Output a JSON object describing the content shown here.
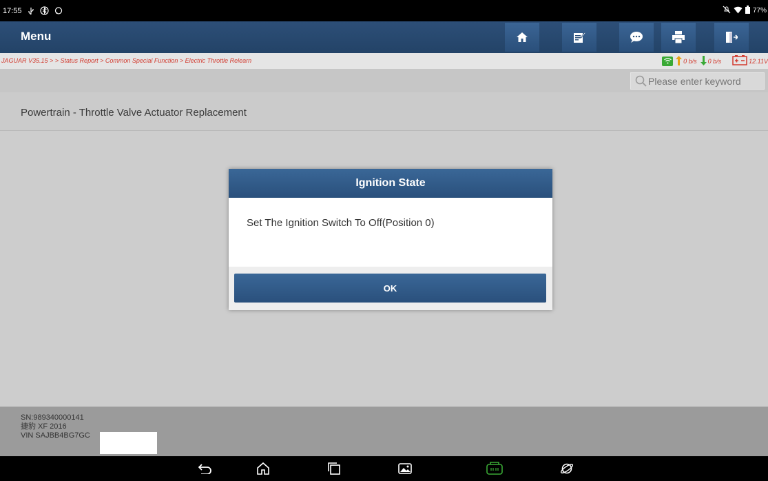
{
  "status_bar": {
    "time": "17:55",
    "battery": "77%",
    "left_icons": [
      "usb-icon",
      "bluetooth-icon",
      "message-icon"
    ],
    "right_icons": [
      "mute-icon",
      "wifi-icon",
      "battery-icon"
    ]
  },
  "header": {
    "title": "Menu",
    "buttons": [
      "home-icon",
      "edit-icon",
      "chat-icon",
      "print-icon",
      "exit-icon"
    ]
  },
  "breadcrumb": "JAGUAR V35.15 > > Status Report > Common Special Function > Electric Throttle Relearn",
  "network": {
    "up": "0 b/s",
    "down": "0 b/s",
    "voltage": "12.11V"
  },
  "search": {
    "placeholder": "Please enter keyword"
  },
  "page_title": "Powertrain - Throttle Valve Actuator Replacement",
  "dialog": {
    "title": "Ignition State",
    "message": "Set The Ignition Switch To Off(Position 0)",
    "ok_label": "OK"
  },
  "vehicle_info": {
    "sn": "SN:989340000141",
    "model": "捷豹 XF 2016",
    "vin": "VIN SAJBB4BG7GC"
  },
  "nav_bar": [
    "back-icon",
    "home-icon",
    "recents-icon",
    "gallery-icon",
    "vci-icon",
    "browser-icon"
  ],
  "colors": {
    "header": "#2a4f7a",
    "breadcrumb_text": "#d23a2e",
    "wifi_badge": "#3aa935",
    "arrow_up": "#e8a317",
    "arrow_down": "#3aa935"
  }
}
